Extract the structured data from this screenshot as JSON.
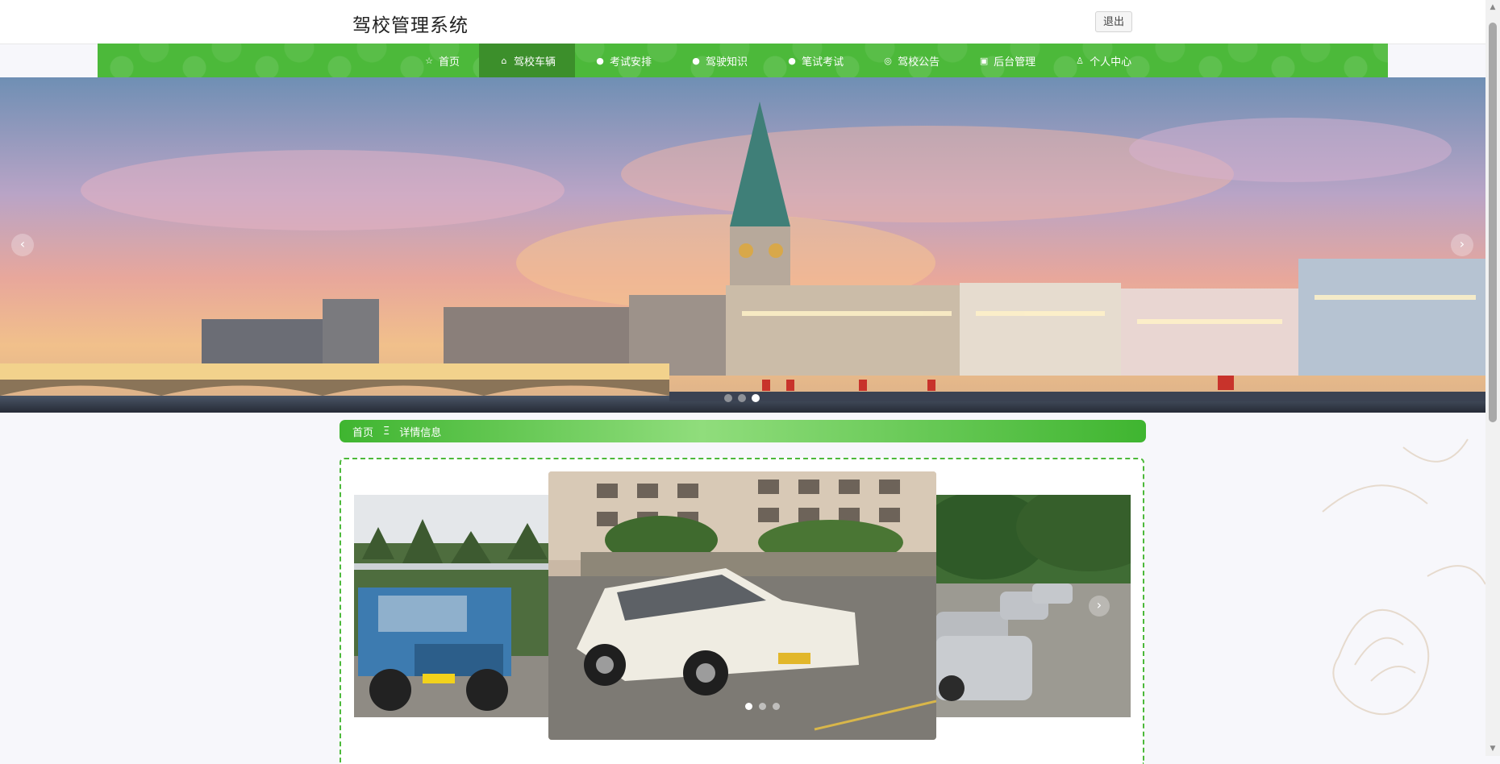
{
  "header": {
    "site_title": "驾校管理系统",
    "logout_label": "退出"
  },
  "nav": {
    "items": [
      {
        "label": "首页",
        "icon": "star-icon",
        "glyph": "☆",
        "active": false
      },
      {
        "label": "驾校车辆",
        "icon": "bag-icon",
        "glyph": "⌂",
        "active": true
      },
      {
        "label": "考试安排",
        "icon": "info-icon",
        "glyph": "●",
        "active": false
      },
      {
        "label": "驾驶知识",
        "icon": "help-icon",
        "glyph": "●",
        "active": false
      },
      {
        "label": "笔试考试",
        "icon": "info-icon",
        "glyph": "●",
        "active": false
      },
      {
        "label": "驾校公告",
        "icon": "globe-icon",
        "glyph": "◎",
        "active": false
      },
      {
        "label": "后台管理",
        "icon": "briefcase-icon",
        "glyph": "▣",
        "active": false
      },
      {
        "label": "个人中心",
        "icon": "user-icon",
        "glyph": "♙",
        "active": false
      }
    ]
  },
  "banner": {
    "slides": 3,
    "active_slide": 3,
    "prev": "‹",
    "next": "›"
  },
  "breadcrumb": {
    "home": "首页",
    "separator": "Ξ",
    "current": "详情信息"
  },
  "detail_carousel": {
    "slides": 3,
    "active_slide": 1,
    "next": "›"
  },
  "colors": {
    "brand_green": "#4cb93a",
    "active_nav": "#3c8f2b"
  }
}
